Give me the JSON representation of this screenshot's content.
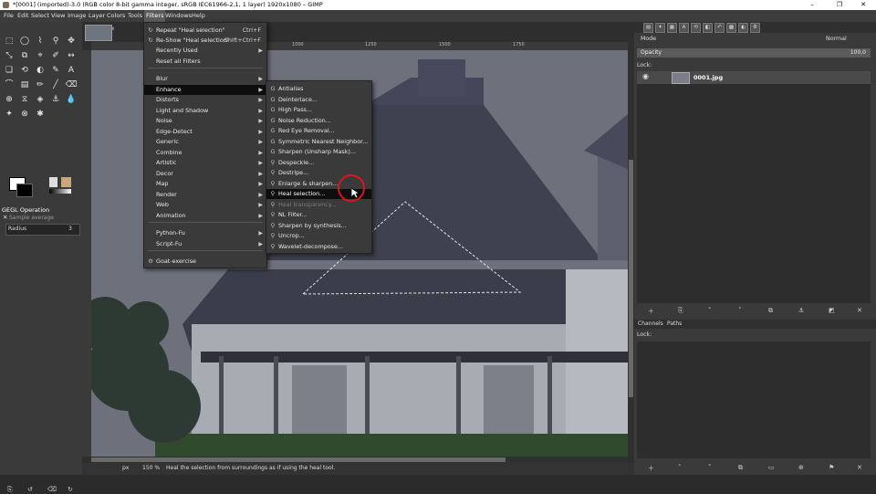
{
  "window": {
    "title": "*[0001] (imported)-3.0 (RGB color 8-bit gamma integer, sRGB IEC61966-2.1, 1 layer) 1920x1080 – GIMP",
    "minimize": "–",
    "maximize": "❐",
    "close": "✕"
  },
  "menubar": [
    "File",
    "Edit",
    "Select",
    "View",
    "Image",
    "Layer",
    "Colors",
    "Tools",
    "Filters",
    "Windows",
    "Help"
  ],
  "toolbox": {
    "tools": [
      "⬚",
      "◯",
      "⌇",
      "⚲",
      "✥",
      "⤡",
      "⧉",
      "⌖",
      "✐",
      "↔",
      "❏",
      "⟲",
      "◐",
      "✎",
      "A",
      "⌒",
      "▤",
      "✏",
      "╱",
      "⌫",
      "⊕",
      "⧖",
      "◈",
      "⚓",
      "💧",
      "✦",
      "⊗",
      "✱"
    ],
    "gegl_title": "GEGL Operation",
    "gegl_sub": "Sample average",
    "radius_label": "Radius",
    "radius_value": "3",
    "footer": [
      "⎘",
      "↺",
      "⌫",
      "↻"
    ]
  },
  "canvas": {
    "tab_close": "x",
    "ruler_labels": [
      "1000",
      "1250",
      "1500",
      "1750"
    ],
    "zoom": "px",
    "zoom_value": "150 %",
    "status": "Heal the selection from surroundings as if using the heal tool."
  },
  "filters_menu": [
    {
      "label": "Repeat \"Heal selection\"",
      "shortcut": "Ctrl+F",
      "icon": "↻"
    },
    {
      "label": "Re-Show \"Heal selection\"",
      "shortcut": "Shift+Ctrl+F",
      "icon": "↻"
    },
    {
      "label": "Recently Used",
      "shortcut": "",
      "icon": ""
    },
    {
      "label": "Reset all Filters",
      "shortcut": "",
      "icon": ""
    },
    {
      "label": "Blur",
      "shortcut": "",
      "icon": ""
    },
    {
      "label": "Enhance",
      "shortcut": "",
      "icon": ""
    },
    {
      "label": "Distorts",
      "shortcut": "",
      "icon": ""
    },
    {
      "label": "Light and Shadow",
      "shortcut": "",
      "icon": ""
    },
    {
      "label": "Noise",
      "shortcut": "",
      "icon": ""
    },
    {
      "label": "Edge-Detect",
      "shortcut": "",
      "icon": ""
    },
    {
      "label": "Generic",
      "shortcut": "",
      "icon": ""
    },
    {
      "label": "Combine",
      "shortcut": "",
      "icon": ""
    },
    {
      "label": "Artistic",
      "shortcut": "",
      "icon": ""
    },
    {
      "label": "Decor",
      "shortcut": "",
      "icon": ""
    },
    {
      "label": "Map",
      "shortcut": "",
      "icon": ""
    },
    {
      "label": "Render",
      "shortcut": "",
      "icon": ""
    },
    {
      "label": "Web",
      "shortcut": "",
      "icon": ""
    },
    {
      "label": "Animation",
      "shortcut": "",
      "icon": ""
    },
    {
      "label": "Python-Fu",
      "shortcut": "",
      "icon": ""
    },
    {
      "label": "Script-Fu",
      "shortcut": "",
      "icon": ""
    },
    {
      "label": "Goat-exercise",
      "shortcut": "",
      "icon": "⚙"
    }
  ],
  "enhance_menu": [
    {
      "label": "Antialias",
      "icon": "G"
    },
    {
      "label": "Deinterlace...",
      "icon": "G"
    },
    {
      "label": "High Pass...",
      "icon": "G"
    },
    {
      "label": "Noise Reduction...",
      "icon": "G"
    },
    {
      "label": "Red Eye Removal...",
      "icon": "G"
    },
    {
      "label": "Symmetric Nearest Neighbor...",
      "icon": "G"
    },
    {
      "label": "Sharpen (Unsharp Mask)...",
      "icon": "G"
    },
    {
      "label": "Despeckle...",
      "icon": "⚲"
    },
    {
      "label": "Destripe...",
      "icon": "⚲"
    },
    {
      "label": "Enlarge & sharpen...",
      "icon": "⚲"
    },
    {
      "label": "Heal selection...",
      "icon": "⚲"
    },
    {
      "label": "Heal transparency...",
      "icon": "⚲"
    },
    {
      "label": "NL Filter...",
      "icon": "⚲"
    },
    {
      "label": "Sharpen by synthesis...",
      "icon": "⚲"
    },
    {
      "label": "Uncrop...",
      "icon": "⚲"
    },
    {
      "label": "Wavelet-decompose...",
      "icon": "⚲"
    }
  ],
  "dock": {
    "mode_label": "Mode",
    "mode_value": "Normal",
    "opacity_label": "Opacity",
    "opacity_value": "100,0",
    "lock_label": "Lock:",
    "layer_name": "0001.jpg",
    "channels_tab": "Channels",
    "paths_tab": "Paths",
    "footer_icons": [
      "＋",
      "⎘",
      "˄",
      "˅",
      "⧉",
      "⚓",
      "◩",
      "✕"
    ],
    "paths_footer_icons": [
      "＋",
      "˄",
      "˅",
      "⧉",
      "▭",
      "⊕",
      "⚑",
      "✕"
    ]
  },
  "colors": {
    "highlight": "#0e0e0e",
    "selection_ring": "#d8171c",
    "photo_sky": "#6e707b",
    "roof": "#3f4150"
  }
}
